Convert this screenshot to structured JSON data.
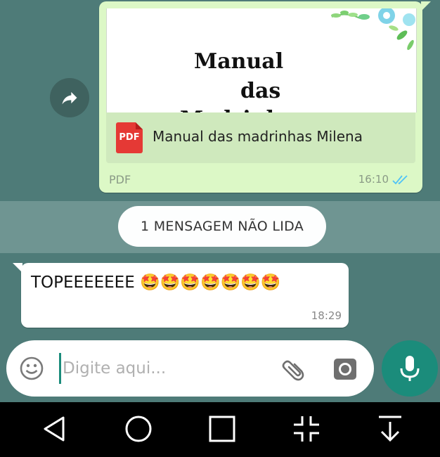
{
  "outgoing_document": {
    "preview_title_lines": [
      "Manual",
      "das",
      "Madrinhas"
    ],
    "file_icon_label": "PDF",
    "file_name": "Manual das madrinhas Milena",
    "file_type": "PDF",
    "time": "16:10",
    "status_icon": "double-check-read-icon",
    "read_color": "#4fc3f7"
  },
  "forward_icon": "forward-arrow-icon",
  "unread_banner": {
    "text": "1 MENSAGEM NÃO LIDA"
  },
  "incoming_message": {
    "text": "TOPEEEEEEE 🤩🤩🤩🤩🤩🤩🤩",
    "time": "18:29"
  },
  "composer": {
    "placeholder": "Digite aqui...",
    "value": "",
    "emoji_icon": "emoji-face-icon",
    "attach_icon": "paperclip-icon",
    "camera_icon": "camera-icon",
    "mic_icon": "microphone-icon"
  },
  "navigation": {
    "buttons": [
      "back-triangle-icon",
      "home-circle-icon",
      "recents-square-icon",
      "fullscreen-collapse-icon",
      "hide-keyboard-arrow-icon"
    ]
  },
  "colors": {
    "wallpaper": "#4e7b78",
    "outgoing_bubble": "#dcf8c6",
    "accent": "#1b8c7b",
    "pdf_red": "#e53935"
  }
}
